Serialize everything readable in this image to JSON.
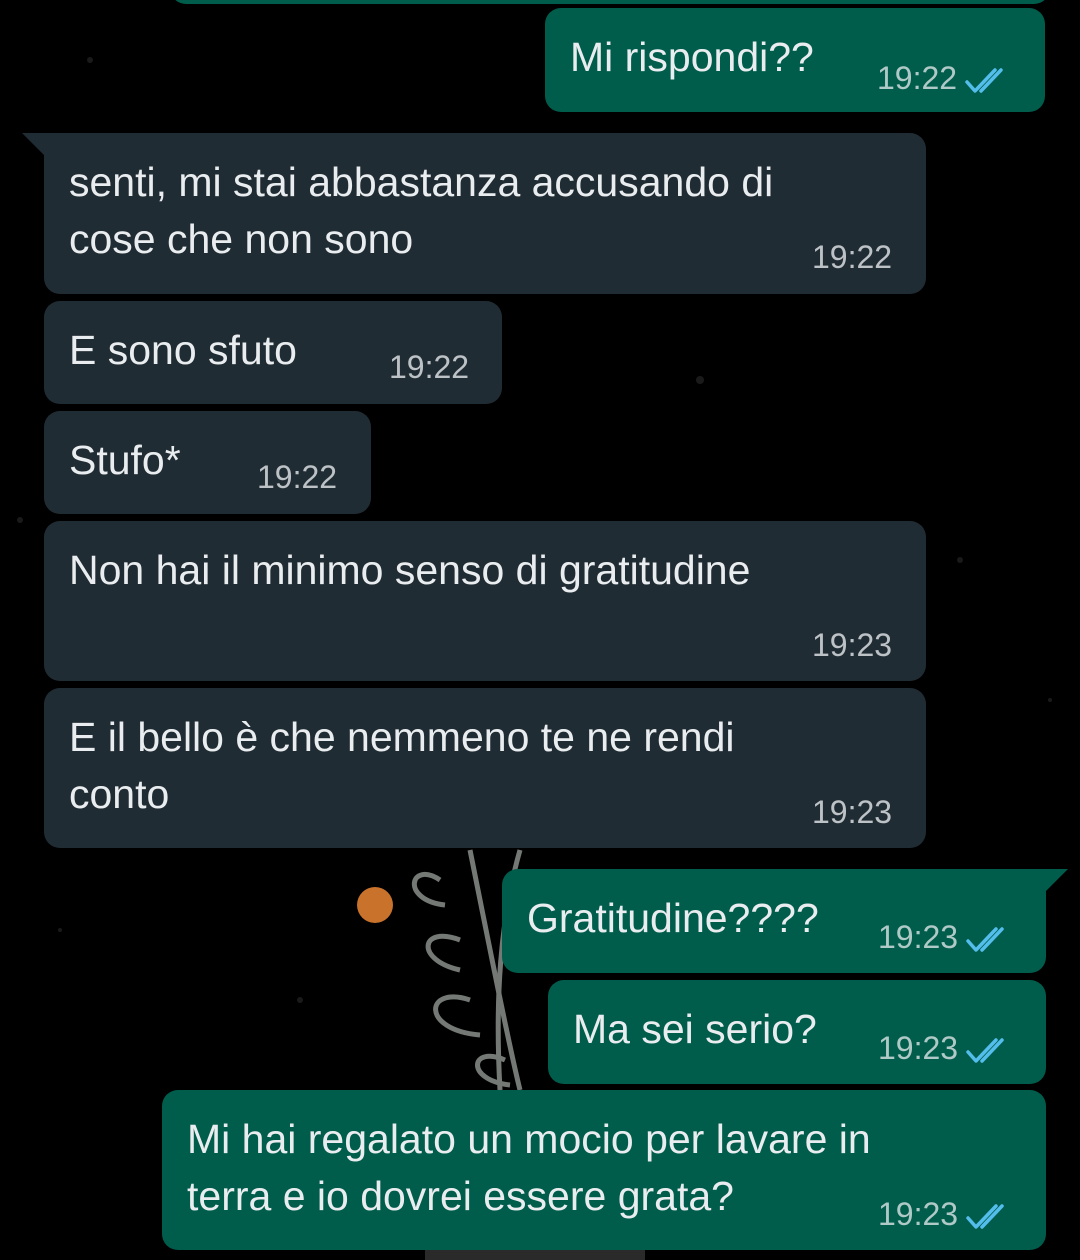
{
  "colors": {
    "incoming_bubble": "#202c33",
    "outgoing_bubble": "#005c4b",
    "read_ticks": "#53bdeb",
    "background": "#000000"
  },
  "messages": [
    {
      "direction": "outgoing",
      "text": "Mi rispondi??",
      "time": "19:22",
      "status": "read"
    },
    {
      "direction": "incoming",
      "text": "senti, mi stai abbastanza accusando di\ncose che non sono",
      "time": "19:22"
    },
    {
      "direction": "incoming",
      "text": "E sono sfuto",
      "time": "19:22"
    },
    {
      "direction": "incoming",
      "text": "Stufo*",
      "time": "19:22"
    },
    {
      "direction": "incoming",
      "text": "Non hai il minimo senso di gratitudine",
      "time": "19:23"
    },
    {
      "direction": "incoming",
      "text": "E il bello è che nemmeno te ne rendi\nconto",
      "time": "19:23"
    },
    {
      "direction": "outgoing",
      "text": "Gratitudine????",
      "time": "19:23",
      "status": "read"
    },
    {
      "direction": "outgoing",
      "text": "Ma sei serio?",
      "time": "19:23",
      "status": "read"
    },
    {
      "direction": "outgoing",
      "text": "Mi hai regalato un mocio per lavare in\nterra e io dovrei essere grata?",
      "time": "19:23",
      "status": "read"
    }
  ]
}
